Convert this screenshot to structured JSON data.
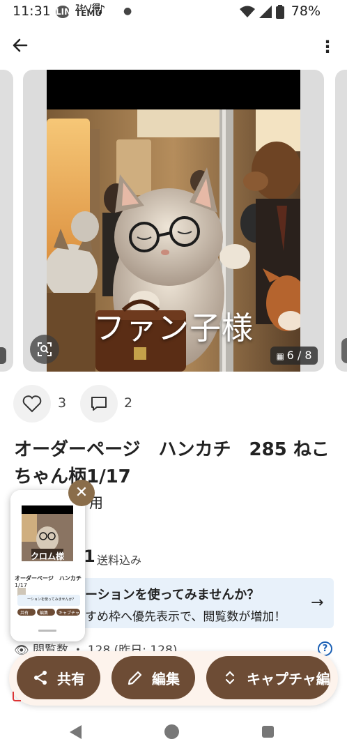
{
  "status_bar": {
    "time": "11:31",
    "line_badge": "LINE",
    "temu_badge_l1": "ｽｷﾍﾉ得",
    "temu_badge_l2": "TEMU",
    "battery": "78%"
  },
  "photo": {
    "caption": "ファン子様",
    "counter": "6 / 8"
  },
  "engagement": {
    "likes": "3",
    "comments": "2"
  },
  "item": {
    "title": "オーダーページ　ハンカチ　285 ねこちゃん柄1/17",
    "subline_partial": "用",
    "price_partial": "1",
    "price_note": "送料込み"
  },
  "promo": {
    "line1": "ーションを使ってみませんか？",
    "line2": "すめ枠へ優先表示で、閲覧数が増加！"
  },
  "views": {
    "text": "閲覧数 ・ 128 (昨日: 128)"
  },
  "actions": {
    "share": "共有",
    "edit": "編集",
    "capture": "キャプチャ編"
  },
  "pip": {
    "caption": "クロム様",
    "title": "オーダーページ　ハンカチ　285 ね",
    "subtitle": "1/17",
    "promo_l1": "ーションを使ってみませんか？",
    "btn_share": "共有",
    "btn_edit": "編集",
    "btn_capture": "キャプチャ"
  },
  "colors": {
    "brand_brown": "#6d4c35",
    "close_brown": "#8a6d4a",
    "promo_bg": "#e8f1fa",
    "fab_bar_bg": "#fdf3ec",
    "help_blue": "#1a5fb4"
  }
}
